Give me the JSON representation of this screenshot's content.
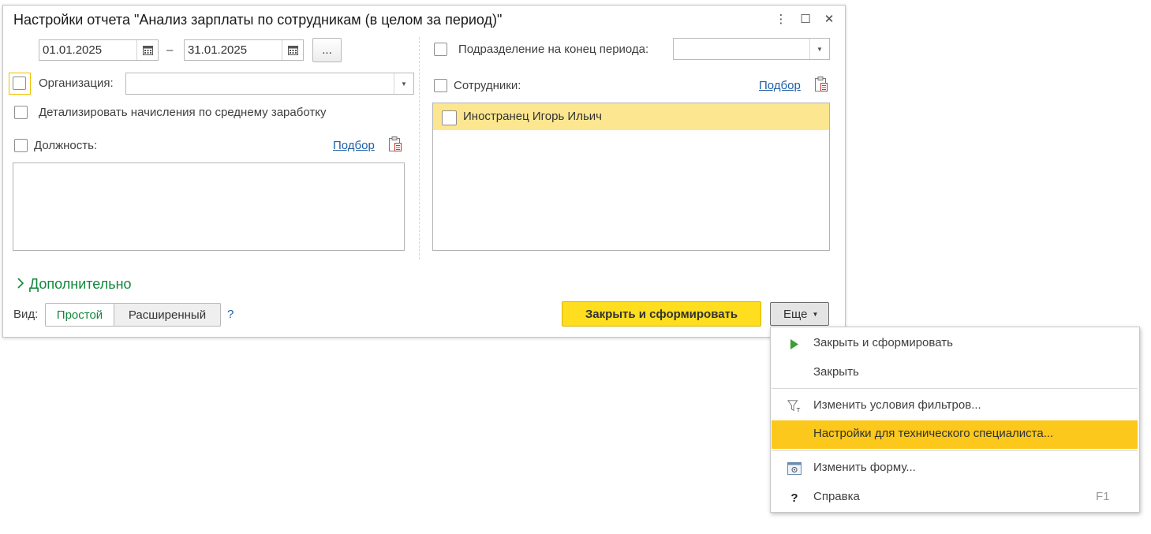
{
  "dialog": {
    "title": "Настройки отчета \"Анализ зарплаты по сотрудникам (в целом за период)\"",
    "window_controls": {
      "menu_glyph": "⋮",
      "maximize_glyph": "☐",
      "close_glyph": "✕"
    }
  },
  "period": {
    "start": "01.01.2025",
    "separator": "–",
    "end": "31.01.2025",
    "more_label": "..."
  },
  "left": {
    "organization_label": "Организация:",
    "organization_value": "",
    "detail_label": "Детализировать начисления по среднему заработку",
    "position_label": "Должность:",
    "position_select_link": "Подбор"
  },
  "right": {
    "department_label": "Подразделение на конец периода:",
    "department_value": "",
    "employees_label": "Сотрудники:",
    "employees_select_link": "Подбор",
    "employees": [
      {
        "name": "Иностранец Игорь Ильич"
      }
    ]
  },
  "additional_label": "Дополнительно",
  "view": {
    "label": "Вид:",
    "simple": "Простой",
    "extended": "Расширенный",
    "help": "?"
  },
  "actions": {
    "generate": "Закрыть и сформировать",
    "more": "Еще"
  },
  "more_menu": {
    "items": [
      {
        "label": "Закрыть и сформировать",
        "icon": "play-icon"
      },
      {
        "label": "Закрыть",
        "icon": ""
      },
      {
        "label": "Изменить условия фильтров...",
        "icon": "filter-icon"
      },
      {
        "label": "Настройки для технического специалиста...",
        "icon": ""
      },
      {
        "label": "Изменить форму...",
        "icon": "form-settings-icon"
      },
      {
        "label": "Справка",
        "icon": "help-icon",
        "shortcut": "F1"
      }
    ],
    "help_glyph": "?"
  },
  "colors": {
    "accent_yellow": "#ffdd1f",
    "highlight_yellow": "#fbc81b",
    "row_yellow": "#fde690",
    "green": "#13863d",
    "link_blue": "#1f5fa8"
  }
}
